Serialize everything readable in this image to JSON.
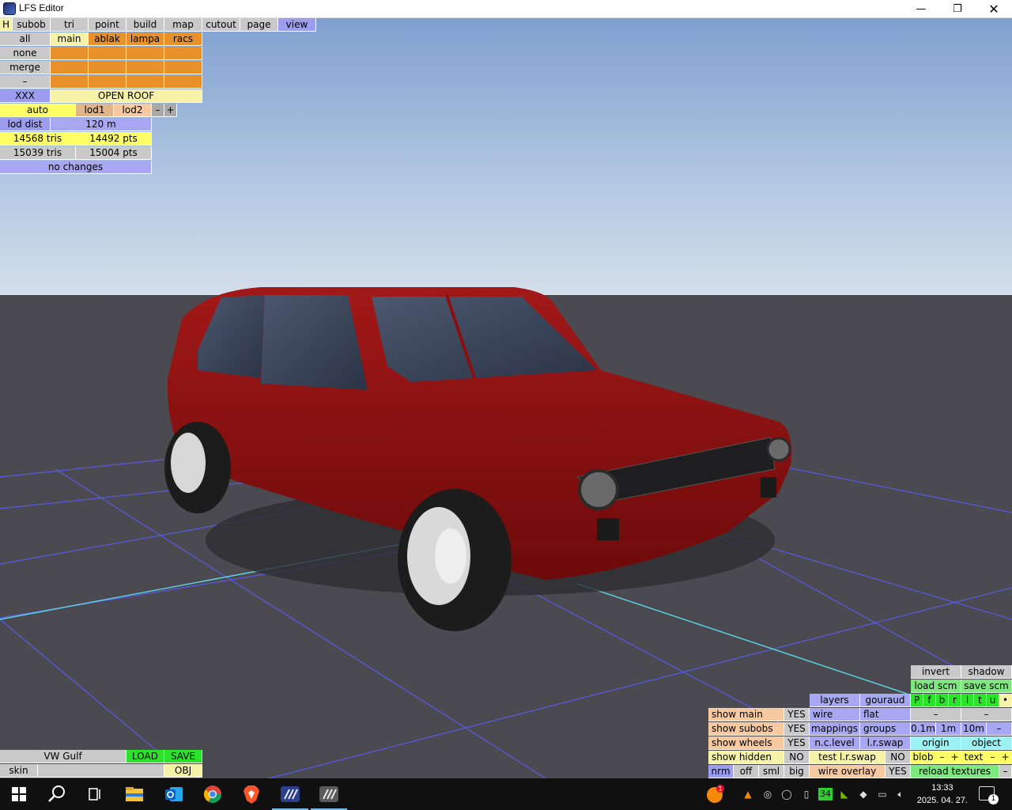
{
  "window": {
    "title": "LFS Editor"
  },
  "top_tabs": [
    "H",
    "subob",
    "tri",
    "point",
    "build",
    "map",
    "cutout",
    "page",
    "view"
  ],
  "subobj": {
    "all": "all",
    "none": "none",
    "merge": "merge",
    "dash": "–",
    "groups": [
      "main",
      "ablak",
      "lampa",
      "racs"
    ],
    "xxx": "XXX",
    "open_roof": "OPEN ROOF",
    "auto": "auto",
    "lod1": "lod1",
    "lod2": "lod2",
    "minus": "–",
    "plus": "+",
    "lod_dist_label": "lod dist",
    "lod_dist_value": "120 m",
    "tris1": "14568 tris",
    "pts1": "14492 pts",
    "tris2": "15039 tris",
    "pts2": "15004 pts",
    "changes": "no changes"
  },
  "bottom_left": {
    "name": "VW Gulf",
    "load": "LOAD",
    "save": "SAVE",
    "skin": "skin",
    "obj": "OBJ"
  },
  "bottom_right": {
    "invert": "invert",
    "shadow": "shadow",
    "load_scm": "load scm",
    "save_scm": "save scm",
    "pfbrltu": [
      "P",
      "f",
      "b",
      "r",
      "l",
      "t",
      "u",
      "•"
    ],
    "layers": "layers",
    "gouraud": "gouraud",
    "dash1": "–",
    "dash2": "–",
    "show_main": "show main",
    "yes1": "YES",
    "wire": "wire",
    "flat": "flat",
    "show_subobs": "show subobs",
    "yes2": "YES",
    "mappings": "mappings",
    "groups": "groups",
    "step_01": "0.1m",
    "step_1": "1m",
    "step_10": "10m",
    "step_minus": "–",
    "show_wheels": "show wheels",
    "yes3": "YES",
    "nc_level": "n.c.level",
    "lr_swap": "l.r.swap",
    "origin": "origin",
    "object": "object",
    "show_hidden": "show hidden",
    "no1": "NO",
    "test_lr_swap": "test l.r.swap",
    "no2": "NO",
    "blob": "blob",
    "blob_minus": "–",
    "blob_plus": "+",
    "text": "text",
    "text_minus": "–",
    "text_plus": "+",
    "nrm": "nrm",
    "off": "off",
    "sml": "sml",
    "big": "big",
    "wire_overlay": "wire overlay",
    "yes4": "YES",
    "reload_textures": "reload textures",
    "end_minus": "–"
  },
  "taskbar": {
    "time": "13:33",
    "date": "2025. 04. 27.",
    "notif_badge": "1",
    "nvidia_num": "34",
    "icons": [
      "start-icon",
      "search-icon",
      "task-view-icon",
      "file-explorer-icon",
      "outlook-icon",
      "chrome-icon",
      "brave-icon",
      "lfs-icon",
      "lfs-editor-icon"
    ]
  }
}
